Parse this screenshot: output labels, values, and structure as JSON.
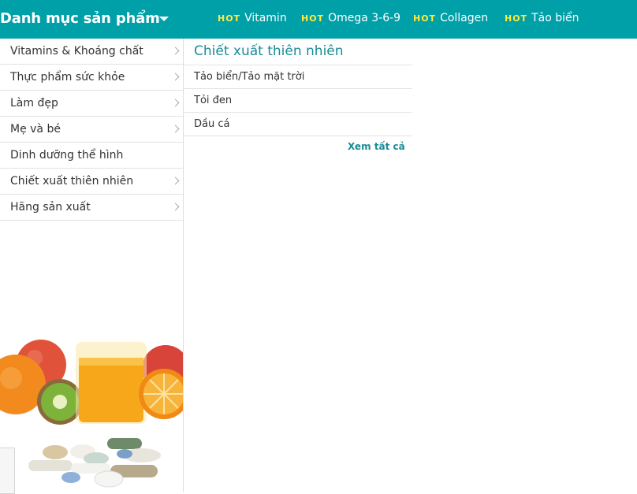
{
  "header": {
    "category_title": "Danh mục sản phẩm",
    "hot_badge": "HOT",
    "hot_links": [
      "Vitamin",
      "Omega 3-6-9",
      "Collagen",
      "Tảo biển"
    ]
  },
  "sidebar": {
    "items": [
      {
        "label": "Vitamins & Khoáng chất",
        "has_submenu": true
      },
      {
        "label": "Thực phẩm sức khỏe",
        "has_submenu": true
      },
      {
        "label": "Làm đẹp",
        "has_submenu": true
      },
      {
        "label": "Mẹ và bé",
        "has_submenu": true
      },
      {
        "label": "Dinh dưỡng thể hình",
        "has_submenu": false
      },
      {
        "label": "Chiết xuất thiên nhiên",
        "has_submenu": true
      },
      {
        "label": "Hãng sản xuất",
        "has_submenu": true
      }
    ]
  },
  "submenu": {
    "title": "Chiết xuất thiên nhiên",
    "links": [
      "Tảo biển/Tảo mặt trời",
      "Tỏi đen",
      "Dầu cá"
    ],
    "see_all": "Xem tất cả"
  },
  "colors": {
    "header_bg": "#00a0a8",
    "hot_badge": "#ffeb3b",
    "accent_text": "#1a8c96"
  },
  "icons": {
    "dropdown": "caret-down-icon",
    "submenu": "chevron-right-icon"
  }
}
